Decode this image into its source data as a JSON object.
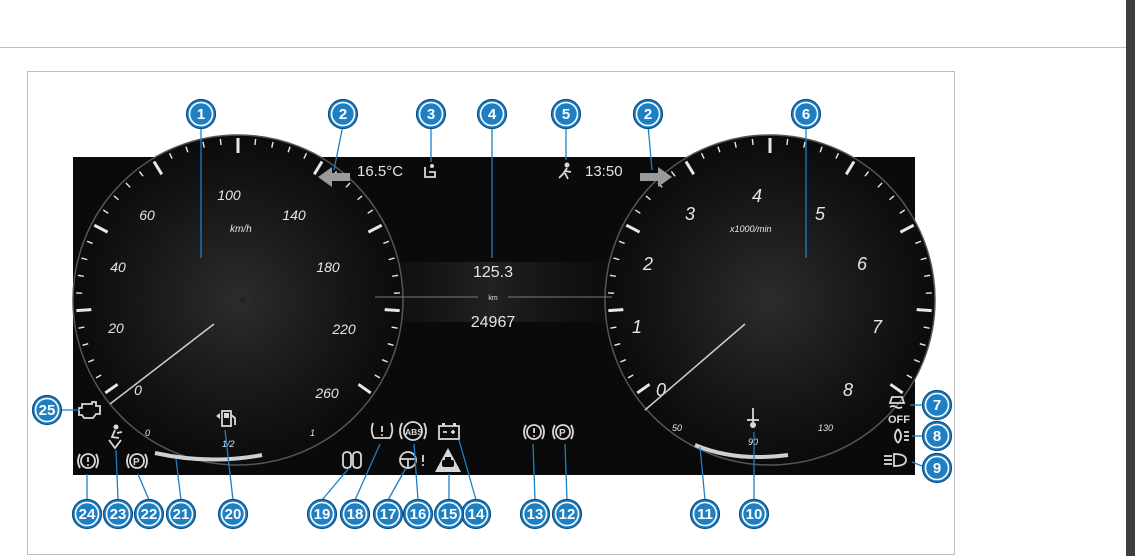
{
  "display": {
    "outside_temp": "16.5°C",
    "clock": "13:50",
    "trip_distance": "125.3",
    "distance_unit": "km",
    "odometer": "24967"
  },
  "speedometer": {
    "unit": "km/h",
    "labels": [
      "0",
      "20",
      "40",
      "60",
      "100",
      "140",
      "180",
      "220",
      "260"
    ]
  },
  "tachometer": {
    "unit": "x1000/min",
    "labels": [
      "0",
      "1",
      "2",
      "3",
      "4",
      "5",
      "6",
      "7",
      "8"
    ]
  },
  "fuel_gauge": {
    "labels": [
      "0",
      "1/2",
      "1"
    ]
  },
  "coolant_gauge": {
    "labels": [
      "50",
      "90",
      "130"
    ]
  },
  "indicator_text": {
    "esp_off": "OFF",
    "abs": "ABS",
    "parking_brake": "P"
  },
  "callouts": [
    "1",
    "2",
    "3",
    "4",
    "5",
    "2",
    "6",
    "7",
    "8",
    "9",
    "10",
    "11",
    "12",
    "13",
    "14",
    "15",
    "16",
    "17",
    "18",
    "19",
    "20",
    "21",
    "22",
    "23",
    "24",
    "25"
  ],
  "colors": {
    "badge": "#1f7fc3",
    "badge_border": "#ffffff",
    "screen": "#0a0a0a",
    "arrow": "#9a9a9a",
    "gauge_arc": "#d8d8d8"
  },
  "icons": [
    "arrow-left-icon",
    "arrow-right-icon",
    "road-ice-icon",
    "seatbelt-icon",
    "esp-off-icon",
    "fog-light-icon",
    "high-beam-icon",
    "coolant-temp-icon",
    "parking-brake-icon",
    "brake-warning-icon",
    "battery-icon",
    "distance-warning-icon",
    "abs-icon",
    "steering-icon",
    "tire-pressure-icon",
    "preglow-icon",
    "fuel-icon",
    "airbag-icon",
    "engine-check-icon"
  ]
}
